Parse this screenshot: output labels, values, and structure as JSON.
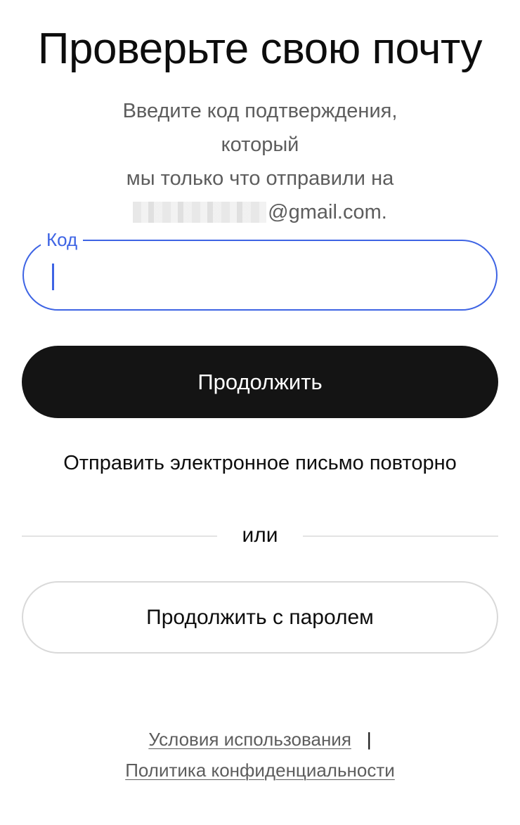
{
  "header": {
    "title": "Проверьте свою почту",
    "subtitle_line1": "Введите код подтверждения, который",
    "subtitle_line2": "мы только что отправили на",
    "email_domain": "@gmail.com."
  },
  "code_field": {
    "label": "Код",
    "value": ""
  },
  "buttons": {
    "continue": "Продолжить",
    "resend": "Отправить электронное письмо повторно",
    "continue_with_password": "Продолжить с паролем"
  },
  "divider": {
    "text": "или"
  },
  "footer": {
    "terms": "Условия использования",
    "separator": "|",
    "privacy": "Политика конфиденциальности"
  },
  "colors": {
    "accent": "#3e64e4",
    "primary_button": "#141414",
    "muted_text": "#5d5d5d",
    "border": "#d9d9d9"
  }
}
